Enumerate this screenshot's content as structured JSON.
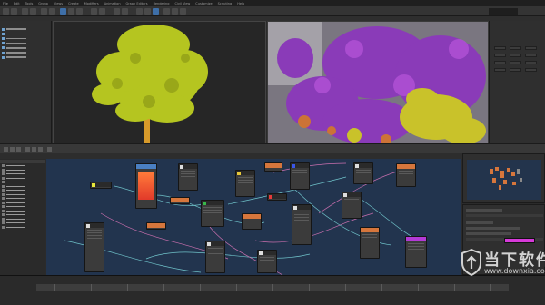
{
  "app": {
    "menu": [
      "File",
      "Edit",
      "Tools",
      "Group",
      "Views",
      "Create",
      "Modifiers",
      "Animation",
      "Graph Editors",
      "Rendering",
      "Civil View",
      "Customize",
      "Scripting",
      "Help"
    ]
  },
  "colors": {
    "node_view_bg": "#22344e",
    "foliage_left": "#b5c520",
    "foliage_purple": "#8a3bb8",
    "foliage_yellow": "#c9c22a",
    "param_swatch": "#d63ad9",
    "watermark": "#f0f0f0"
  },
  "icons": {
    "watermark_logo": "shield-logo-icon"
  },
  "watermark": {
    "cn": "当下软件园",
    "url": "www.downxia.com"
  }
}
